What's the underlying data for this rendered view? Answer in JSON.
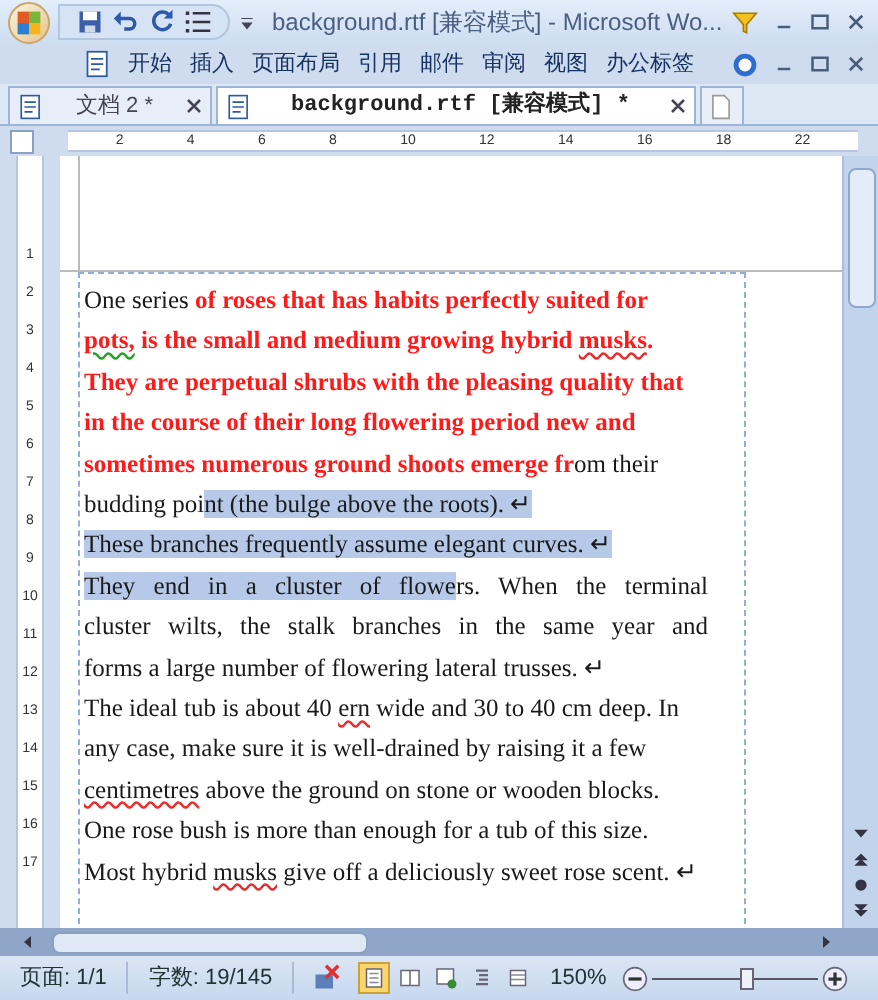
{
  "window": {
    "title": "background.rtf [兼容模式] - Microsoft Wo...",
    "quick_access": [
      {
        "kind": "save"
      },
      {
        "kind": "undo"
      },
      {
        "kind": "redo"
      },
      {
        "kind": "list"
      }
    ]
  },
  "ribbon_tabs": [
    {
      "label": "开始"
    },
    {
      "label": "插入"
    },
    {
      "label": "页面布局"
    },
    {
      "label": "引用"
    },
    {
      "label": "邮件"
    },
    {
      "label": "审阅"
    },
    {
      "label": "视图"
    },
    {
      "label": "办公标签"
    }
  ],
  "doc_tabs": [
    {
      "label": "文档 2 *",
      "selected": false
    },
    {
      "label": "background.rtf [兼容模式] *",
      "selected": true
    }
  ],
  "ruler": {
    "horizontal": [
      "2",
      "4",
      "6",
      "8",
      "10",
      "12",
      "14",
      "16",
      "18",
      "22"
    ],
    "vertical": [
      "1",
      "2",
      "3",
      "4",
      "5",
      "6",
      "7",
      "8",
      "9",
      "10",
      "11",
      "12",
      "13",
      "14",
      "15",
      "16",
      "17"
    ]
  },
  "document": {
    "lines": [
      {
        "justify": false,
        "segments": [
          {
            "text": "One series ",
            "red": false,
            "selected": false
          },
          {
            "text": "of roses that has habits perfectly suited for",
            "red": true,
            "selected": false
          }
        ]
      },
      {
        "justify": false,
        "segments": [
          {
            "text": "pots,",
            "red": true,
            "selected": false,
            "grammar_error": true
          },
          {
            "text": " is the small and medium growing hybrid ",
            "red": true,
            "selected": false
          },
          {
            "text": "musks",
            "red": true,
            "selected": false,
            "spelling_error": true
          },
          {
            "text": ".",
            "red": true,
            "selected": false
          }
        ]
      },
      {
        "justify": false,
        "segments": [
          {
            "text": "They are perpetual shrubs with the pleasing quality that",
            "red": true,
            "selected": false
          }
        ]
      },
      {
        "justify": false,
        "segments": [
          {
            "text": "in the course of their long flowering period new and",
            "red": true,
            "selected": false
          }
        ]
      },
      {
        "justify": false,
        "segments": [
          {
            "text": "sometimes numerous ground shoots emerge fr",
            "red": true,
            "selected": false
          },
          {
            "text": "om their",
            "red": false,
            "selected": false
          }
        ]
      },
      {
        "justify": false,
        "segments": [
          {
            "text": "budding poi",
            "red": false,
            "selected": false
          },
          {
            "text": "nt (the bulge above the roots). ↵",
            "red": false,
            "selected": true
          }
        ]
      },
      {
        "justify": false,
        "segments": [
          {
            "text": "These branches frequently assume elegant curves. ↵",
            "red": false,
            "selected": true
          }
        ]
      },
      {
        "justify": true,
        "segments": [
          {
            "text": "They end in a cluster of flowe",
            "red": false,
            "selected": true
          },
          {
            "text": "rs. When the terminal",
            "red": false,
            "selected": false
          }
        ]
      },
      {
        "justify": true,
        "segments": [
          {
            "text": "cluster wilts, the stalk branches in the same year and",
            "red": false,
            "selected": false
          }
        ]
      },
      {
        "justify": false,
        "segments": [
          {
            "text": "forms a large number of flowering lateral trusses. ↵",
            "red": false,
            "selected": false
          }
        ]
      },
      {
        "justify": false,
        "segments": [
          {
            "text": "The ideal tub is about 40 ",
            "red": false,
            "selected": false
          },
          {
            "text": "ern",
            "red": false,
            "selected": false,
            "spelling_error": true
          },
          {
            "text": " wide and 30 to 40 cm deep. In",
            "red": false,
            "selected": false
          }
        ]
      },
      {
        "justify": false,
        "segments": [
          {
            "text": "any case, make sure it is well-drained by raising it a few",
            "red": false,
            "selected": false
          }
        ]
      },
      {
        "justify": false,
        "segments": [
          {
            "text": "centimetres",
            "red": false,
            "selected": false,
            "spelling_error": true
          },
          {
            "text": " above the ground on stone or wooden blocks.",
            "red": false,
            "selected": false
          }
        ]
      },
      {
        "justify": false,
        "segments": [
          {
            "text": "One rose bush is more than enough for a tub of this size.",
            "red": false,
            "selected": false
          }
        ]
      },
      {
        "justify": false,
        "segments": [
          {
            "text": "Most hybrid ",
            "red": false,
            "selected": false
          },
          {
            "text": "musks",
            "red": false,
            "selected": false,
            "spelling_error": true
          },
          {
            "text": " give off a deliciously sweet rose scent. ↵",
            "red": false,
            "selected": false
          }
        ]
      }
    ]
  },
  "status_bar": {
    "page": "页面: 1/1",
    "words": "字数: 19/145",
    "views": [
      {
        "selected": true
      },
      {
        "selected": false
      },
      {
        "selected": false
      },
      {
        "selected": false
      },
      {
        "selected": false
      }
    ],
    "zoom": "150%",
    "zoom_slider": {
      "level": 0.57
    }
  }
}
